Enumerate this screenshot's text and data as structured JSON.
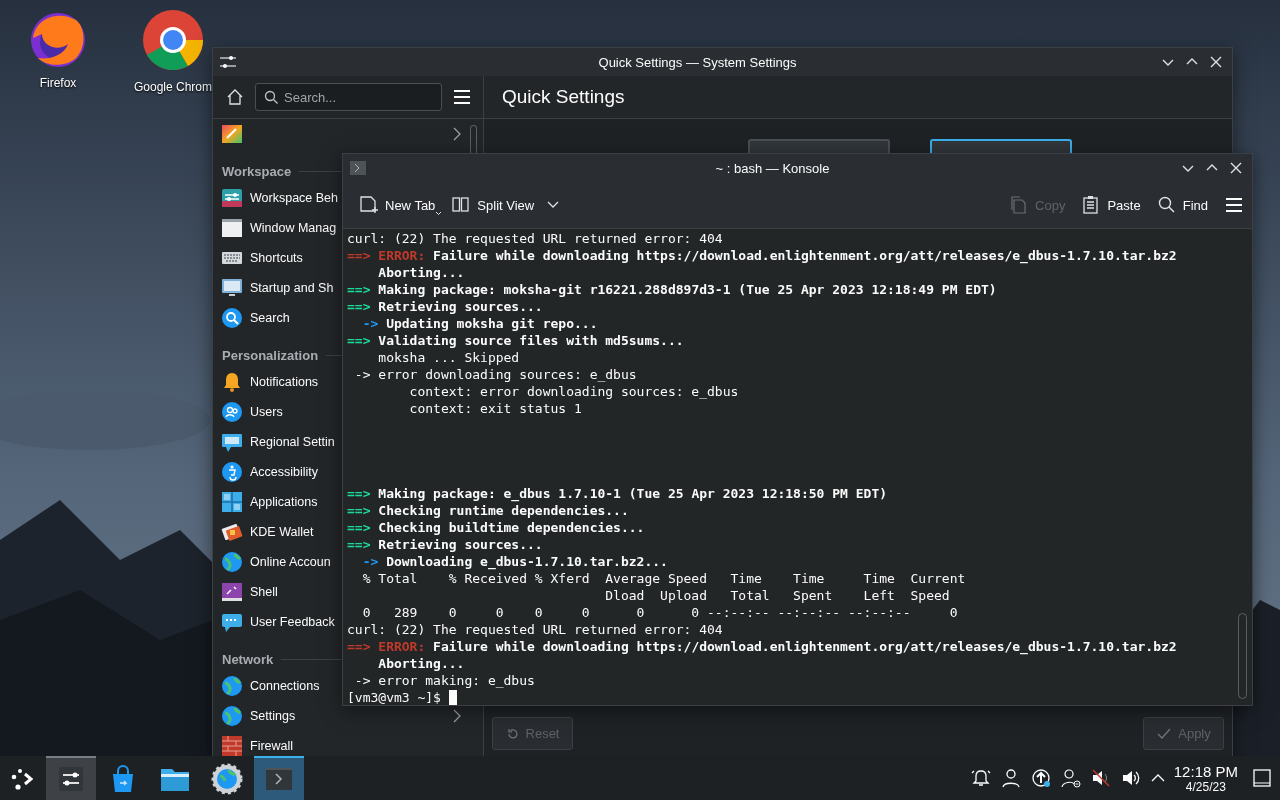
{
  "desktop": {
    "icons": [
      {
        "label": "Firefox"
      },
      {
        "label": "Google Chrom"
      }
    ]
  },
  "settings_window": {
    "title": "Quick Settings — System Settings",
    "search": {
      "placeholder": "Search..."
    },
    "sidebar": {
      "top_item": {
        "has_children": true
      },
      "sections": [
        {
          "heading": "Workspace",
          "items": [
            {
              "label": "Workspace Beh"
            },
            {
              "label": "Window Manag"
            },
            {
              "label": "Shortcuts"
            },
            {
              "label": "Startup and Sh"
            },
            {
              "label": "Search"
            }
          ]
        },
        {
          "heading": "Personalization",
          "items": [
            {
              "label": "Notifications"
            },
            {
              "label": "Users"
            },
            {
              "label": "Regional Settin"
            },
            {
              "label": "Accessibility"
            },
            {
              "label": "Applications"
            },
            {
              "label": "KDE Wallet"
            },
            {
              "label": "Online Accoun"
            },
            {
              "label": "Shell"
            },
            {
              "label": "User Feedback"
            }
          ]
        },
        {
          "heading": "Network",
          "items": [
            {
              "label": "Connections"
            },
            {
              "label": "Settings",
              "has_children": true
            },
            {
              "label": "Firewall",
              "has_children": false
            }
          ]
        }
      ]
    },
    "page_title": "Quick Settings",
    "thumbnails": [
      {
        "selected": false
      },
      {
        "selected": true
      }
    ],
    "buttons": [
      {
        "label": "Reset",
        "disabled": true
      },
      {
        "label": "Apply",
        "disabled": true
      }
    ]
  },
  "konsole": {
    "title": "~ : bash — Konsole",
    "toolbar": [
      {
        "label": "New Tab",
        "kind": "menu-button",
        "disabled": false
      },
      {
        "label": "Split View",
        "kind": "dropdown",
        "disabled": false
      },
      {
        "label": "Copy",
        "kind": "button",
        "disabled": true
      },
      {
        "label": "Paste",
        "kind": "button",
        "disabled": false
      },
      {
        "label": "Find",
        "kind": "button",
        "disabled": false
      }
    ],
    "output": [
      [
        [
          {
            "kind": "plain",
            "text": "curl: (22) The requested URL returned error: 404"
          }
        ],
        [
          {
            "kind": "error",
            "text": "==> ERROR:"
          },
          {
            "kind": "bold",
            "text": " Failure while downloading https://download.enlightenment.org/att/releases/e_dbus-1.7.10.tar.bz2"
          }
        ],
        [
          {
            "kind": "bold",
            "text": "    Aborting..."
          }
        ],
        [
          {
            "kind": "arrow",
            "text": "==>"
          },
          {
            "kind": "bold",
            "text": " Making package: moksha-git r16221.288d897d3-1 (Tue 25 Apr 2023 12:18:49 PM EDT)"
          }
        ],
        [
          {
            "kind": "arrow",
            "text": "==>"
          },
          {
            "kind": "bold",
            "text": " Retrieving sources..."
          }
        ],
        [
          {
            "kind": "sub",
            "text": "  ->"
          },
          {
            "kind": "bold",
            "text": " Updating moksha git repo..."
          }
        ],
        [
          {
            "kind": "arrow",
            "text": "==>"
          },
          {
            "kind": "bold",
            "text": " Validating source files with md5sums..."
          }
        ],
        [
          {
            "kind": "plain",
            "text": "    moksha ... Skipped"
          }
        ],
        [
          {
            "kind": "plain",
            "text": " -> error downloading sources: e_dbus"
          }
        ],
        [
          {
            "kind": "plain",
            "text": "        context: error downloading sources: e_dbus"
          }
        ],
        [
          {
            "kind": "plain",
            "text": "        context: exit status 1"
          }
        ]
      ],
      [
        [
          {
            "kind": "arrow",
            "text": "==>"
          },
          {
            "kind": "bold",
            "text": " Making package: e_dbus 1.7.10-1 (Tue 25 Apr 2023 12:18:50 PM EDT)"
          }
        ],
        [
          {
            "kind": "arrow",
            "text": "==>"
          },
          {
            "kind": "bold",
            "text": " Checking runtime dependencies..."
          }
        ],
        [
          {
            "kind": "arrow",
            "text": "==>"
          },
          {
            "kind": "bold",
            "text": " Checking buildtime dependencies..."
          }
        ],
        [
          {
            "kind": "arrow",
            "text": "==>"
          },
          {
            "kind": "bold",
            "text": " Retrieving sources..."
          }
        ],
        [
          {
            "kind": "sub",
            "text": "  ->"
          },
          {
            "kind": "bold",
            "text": " Downloading e_dbus-1.7.10.tar.bz2..."
          }
        ],
        [
          {
            "kind": "plain",
            "text": "  % Total    % Received % Xferd  Average Speed   Time    Time     Time  Current"
          }
        ],
        [
          {
            "kind": "plain",
            "text": "                                 Dload  Upload   Total   Spent    Left  Speed"
          }
        ],
        [
          {
            "kind": "plain",
            "text": "  0   289    0     0    0     0      0      0 --:--:-- --:--:-- --:--:--     0"
          }
        ],
        [
          {
            "kind": "plain",
            "text": "curl: (22) The requested URL returned error: 404"
          }
        ],
        [
          {
            "kind": "error",
            "text": "==> ERROR:"
          },
          {
            "kind": "bold",
            "text": " Failure while downloading https://download.enlightenment.org/att/releases/e_dbus-1.7.10.tar.bz2"
          }
        ],
        [
          {
            "kind": "bold",
            "text": "    Aborting..."
          }
        ],
        [
          {
            "kind": "plain",
            "text": " -> error making: e_dbus"
          }
        ]
      ]
    ],
    "prompt": "[vm3@vm3 ~]$",
    "cursor": true
  },
  "taskbar": {
    "tasks": [
      {
        "open": true,
        "focused": false
      },
      {
        "open": false,
        "focused": false
      },
      {
        "open": false,
        "focused": false
      },
      {
        "open": false,
        "focused": false
      },
      {
        "open": true,
        "focused": true
      }
    ],
    "clock": {
      "time": "12:18 PM",
      "date": "4/25/23"
    }
  }
}
